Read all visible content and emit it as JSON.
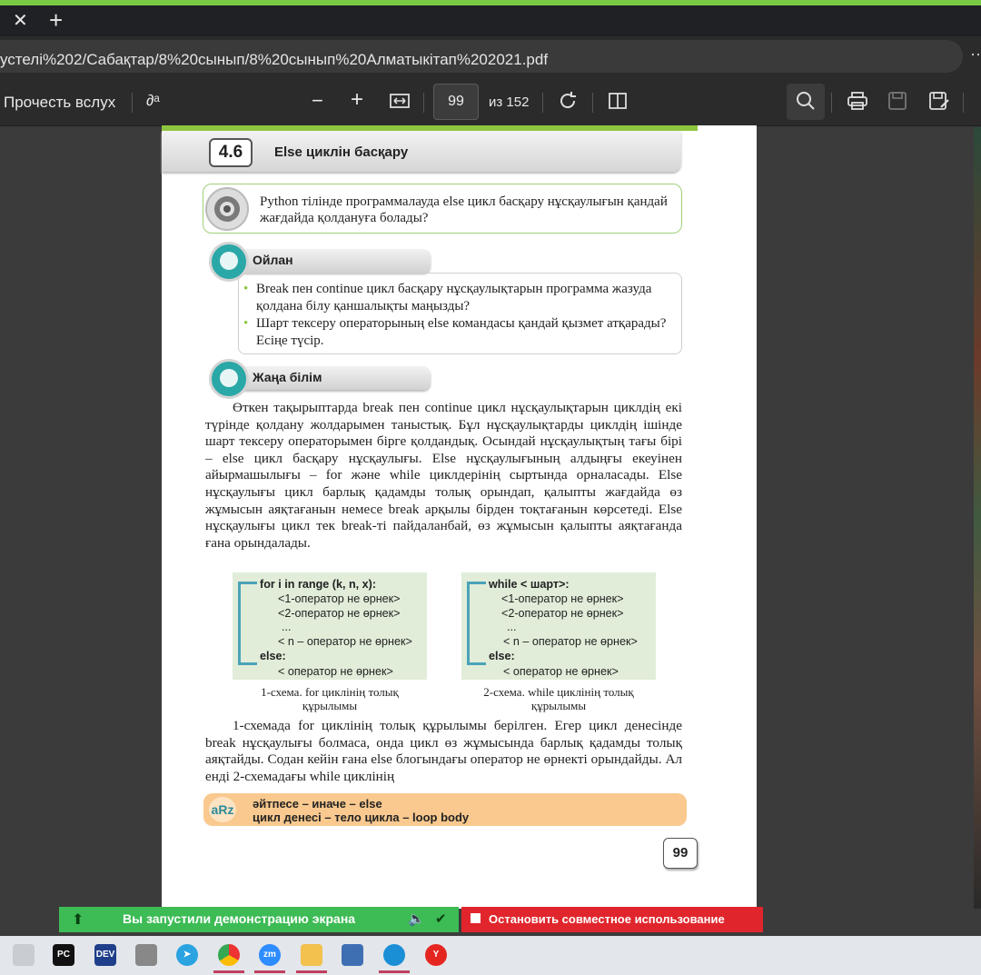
{
  "browser": {
    "tab_close": "✕",
    "tab_new": "+",
    "url": "устелі%202/Сабақтар/8%20сынып/8%20сынып%20Алматыкітап%202021.pdf",
    "more": "⋯"
  },
  "pdf_toolbar": {
    "read_aloud": "Прочесть вслух",
    "translate_icon": "∂ᵃ",
    "zoom_out": "−",
    "zoom_in": "+",
    "current_page": "99",
    "total_pages": "из 152"
  },
  "page": {
    "section_number": "4.6",
    "section_title": "Else циклін басқару",
    "question": "Python тілінде программалауда else цикл басқару нұсқаулығын қандай жағдайда қолдануға болады?",
    "think_label": "Ойлан",
    "think_bullets": [
      "Break пен continue цикл басқару нұсқаулықтарын программа жазуда қолдана білу қаншалықты маңызды?",
      "Шарт тексеру операторының else командасы қандай қызмет атқарады? Есіңе түсір."
    ],
    "new_knowledge_label": "Жаңа білім",
    "paragraph1": "Өткен тақырыптарда break пен continue цикл нұсқаулықтарын циклдің екі түрінде қолдану жолдарымен таныстық. Бұл нұсқаулықтарды циклдің ішінде шарт тексеру операторымен бірге қолдандық. Осындай нұсқаулықтың тағы бірі – else цикл басқару нұсқаулығы. Else нұсқаулығының алдыңғы екеуінен айырмашылығы – for және while циклдерінің сыртында орналасады. Else нұсқаулығы цикл барлық қадамды толық орындап, қалыпты жағдайда өз жұмысын аяқтағанын немесе break арқылы бірден тоқтағанын көрсетеді. Else нұсқаулығы цикл тек break-ті пайдаланбай, өз жұмысын қалыпты аяқтағанда ғана орындалады.",
    "schema1": {
      "lines": [
        "for i in range (k, n, x):",
        "<1-оператор не өрнек>",
        "<2-оператор не өрнек>",
        "...",
        "< n – оператор не өрнек>",
        "else:",
        "< оператор не өрнек>"
      ],
      "caption": "1-схема. for циклінің толық құрылымы"
    },
    "schema2": {
      "lines": [
        "while < шарт>:",
        "<1-оператор не өрнек>",
        "<2-оператор не өрнек>",
        "...",
        "< n – оператор не өрнек>",
        "else:",
        "< оператор не өрнек>"
      ],
      "caption": "2-схема. while циклінің толық құрылымы"
    },
    "paragraph2": "1-схемада for циклінің толық құрылымы берілген. Егер цикл денесінде break нұсқаулығы болмаса, онда цикл өз жұмысында барлық қадамды толық аяқтайды. Содан кейін ғана else блогындағы оператор не өрнекті орындайды. Ал енді 2-схемадағы while циклінің",
    "vocab_icon": "aRz",
    "vocab": [
      "әйтпесе – иначе – else",
      "цикл денесі – тело цикла – loop body"
    ],
    "page_number": "99"
  },
  "screen_share": {
    "message": "Вы запустили демонстрацию экрана",
    "stop_label": "Остановить совместное использование"
  },
  "taskbar": {
    "apps": [
      "file-manager",
      "pycharm",
      "dev-cpp",
      "camera",
      "telegram",
      "chrome",
      "zoom",
      "explorer",
      "python-idle",
      "edge",
      "yandex"
    ]
  },
  "colors": {
    "accent_green": "#8dc63f",
    "share_green": "#3dbb55",
    "stop_red": "#e0262c",
    "vocab_orange": "#f9c98f"
  }
}
